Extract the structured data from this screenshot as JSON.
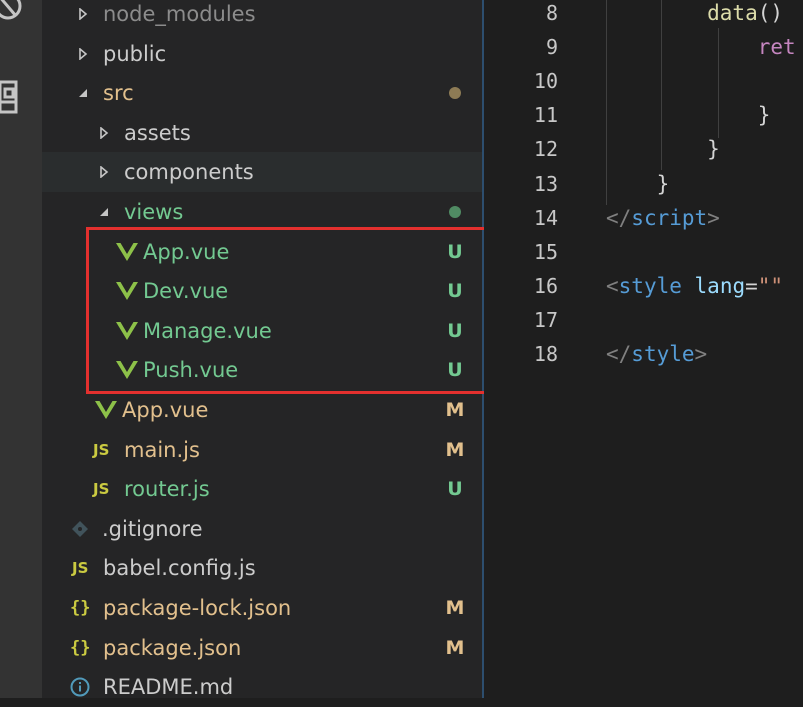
{
  "explorer": {
    "items": [
      {
        "label": "node_modules",
        "type": "folder",
        "expanded": false,
        "depth": 1,
        "color": "#8c8c8c",
        "badge": "",
        "dot": ""
      },
      {
        "label": "public",
        "type": "folder",
        "expanded": false,
        "depth": 1,
        "color": "#cccccc",
        "badge": "",
        "dot": ""
      },
      {
        "label": "src",
        "type": "folder",
        "expanded": true,
        "depth": 1,
        "color": "#e2c08d",
        "badge": "",
        "dot": "#8d7b55"
      },
      {
        "label": "assets",
        "type": "folder",
        "expanded": false,
        "depth": 2,
        "color": "#cccccc",
        "badge": "",
        "dot": ""
      },
      {
        "label": "components",
        "type": "folder",
        "expanded": false,
        "depth": 2,
        "color": "#cccccc",
        "badge": "",
        "dot": "",
        "hover": true
      },
      {
        "label": "views",
        "type": "folder",
        "expanded": true,
        "depth": 2,
        "color": "#73c991",
        "badge": "",
        "dot": "#508b63"
      },
      {
        "label": "App.vue",
        "type": "vue",
        "depth": 3,
        "color": "#73c991",
        "badge": "U",
        "badge_color": "#73c991"
      },
      {
        "label": "Dev.vue",
        "type": "vue",
        "depth": 3,
        "color": "#73c991",
        "badge": "U",
        "badge_color": "#73c991"
      },
      {
        "label": "Manage.vue",
        "type": "vue",
        "depth": 3,
        "color": "#73c991",
        "badge": "U",
        "badge_color": "#73c991"
      },
      {
        "label": "Push.vue",
        "type": "vue",
        "depth": 3,
        "color": "#73c991",
        "badge": "U",
        "badge_color": "#73c991"
      },
      {
        "label": "App.vue",
        "type": "vue",
        "depth": 2,
        "color": "#e2c08d",
        "badge": "M",
        "badge_color": "#e2c08d"
      },
      {
        "label": "main.js",
        "type": "js",
        "depth": 2,
        "color": "#e2c08d",
        "badge": "M",
        "badge_color": "#e2c08d"
      },
      {
        "label": "router.js",
        "type": "js",
        "depth": 2,
        "color": "#73c991",
        "badge": "U",
        "badge_color": "#73c991"
      },
      {
        "label": ".gitignore",
        "type": "git",
        "depth": 1,
        "color": "#cccccc",
        "badge": "",
        "dot": ""
      },
      {
        "label": "babel.config.js",
        "type": "js",
        "depth": 1,
        "color": "#cccccc",
        "badge": "",
        "dot": ""
      },
      {
        "label": "package-lock.json",
        "type": "json",
        "depth": 1,
        "color": "#e2c08d",
        "badge": "M",
        "badge_color": "#e2c08d"
      },
      {
        "label": "package.json",
        "type": "json",
        "depth": 1,
        "color": "#e2c08d",
        "badge": "M",
        "badge_color": "#e2c08d"
      },
      {
        "label": "README.md",
        "type": "info",
        "depth": 1,
        "color": "#cccccc",
        "badge": "",
        "dot": ""
      }
    ]
  },
  "icons": {
    "js": "JS",
    "json": "{}"
  },
  "editor": {
    "lines": [
      {
        "num": "8",
        "tokens": [
          {
            "t": "        data",
            "c": "c-fn"
          },
          {
            "t": "()",
            "c": "c-pl"
          }
        ]
      },
      {
        "num": "9",
        "tokens": [
          {
            "t": "            ret",
            "c": "c-kw"
          }
        ]
      },
      {
        "num": "10",
        "tokens": []
      },
      {
        "num": "11",
        "tokens": [
          {
            "t": "            }",
            "c": "c-pl"
          }
        ]
      },
      {
        "num": "12",
        "tokens": [
          {
            "t": "        }",
            "c": "c-pl"
          }
        ]
      },
      {
        "num": "13",
        "tokens": [
          {
            "t": "    }",
            "c": "c-pl"
          }
        ]
      },
      {
        "num": "14",
        "tokens": [
          {
            "t": "</",
            "c": "c-brk"
          },
          {
            "t": "script",
            "c": "c-tag"
          },
          {
            "t": ">",
            "c": "c-brk"
          }
        ]
      },
      {
        "num": "15",
        "tokens": []
      },
      {
        "num": "16",
        "tokens": [
          {
            "t": "<",
            "c": "c-brk"
          },
          {
            "t": "style",
            "c": "c-tag"
          },
          {
            "t": " ",
            "c": "c-pl"
          },
          {
            "t": "lang",
            "c": "c-attr"
          },
          {
            "t": "=",
            "c": "c-pl"
          },
          {
            "t": "\"\"",
            "c": "c-str"
          }
        ]
      },
      {
        "num": "17",
        "tokens": []
      },
      {
        "num": "18",
        "tokens": [
          {
            "t": "</",
            "c": "c-brk"
          },
          {
            "t": "style",
            "c": "c-tag"
          },
          {
            "t": ">",
            "c": "c-brk"
          }
        ]
      }
    ]
  }
}
